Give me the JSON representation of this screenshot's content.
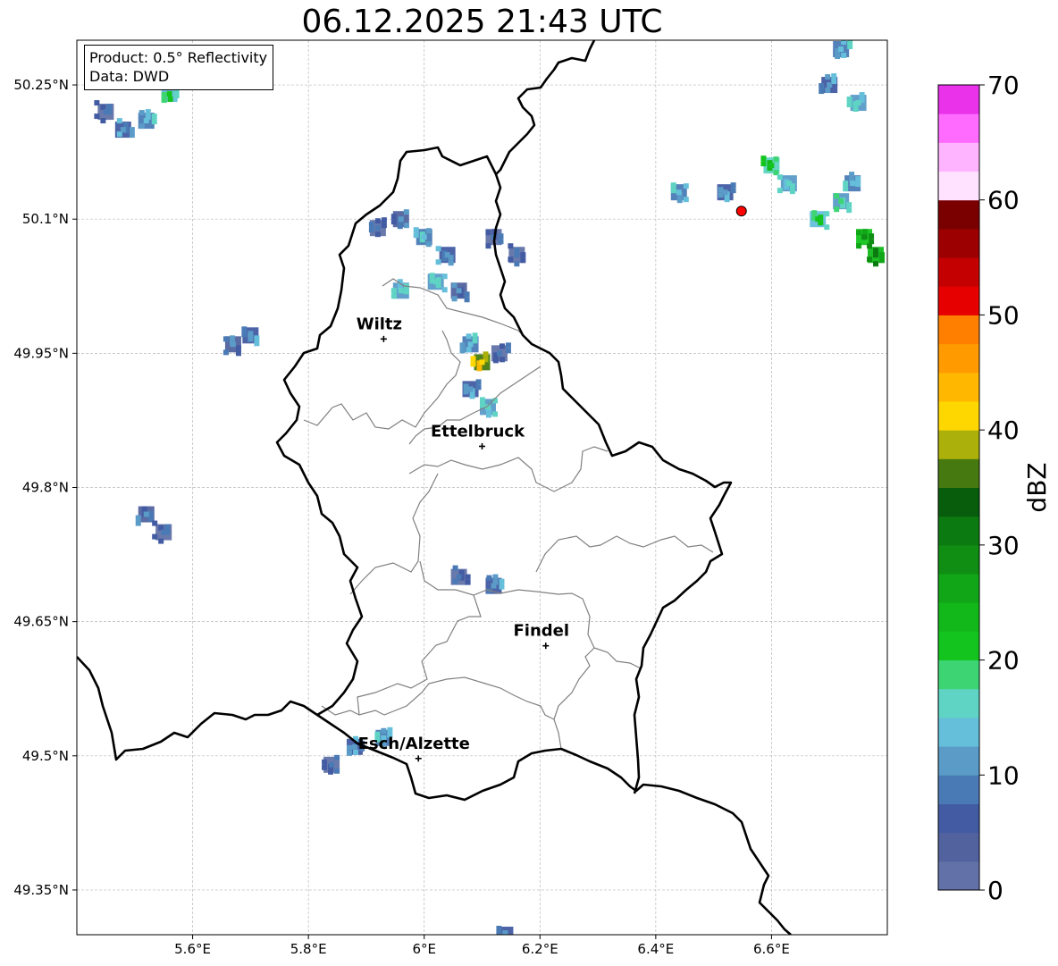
{
  "title": "06.12.2025 21:43 UTC",
  "info_box": {
    "product_line": "Product: 0.5° Reflectivity",
    "data_line": "Data: DWD"
  },
  "map": {
    "lon_range": [
      5.4,
      6.8
    ],
    "lat_range": [
      49.3,
      50.3
    ],
    "lon_ticks": [
      {
        "value": 5.6,
        "label": "5.6°E"
      },
      {
        "value": 5.8,
        "label": "5.8°E"
      },
      {
        "value": 6.0,
        "label": "6°E"
      },
      {
        "value": 6.2,
        "label": "6.2°E"
      },
      {
        "value": 6.4,
        "label": "6.4°E"
      },
      {
        "value": 6.6,
        "label": "6.6°E"
      }
    ],
    "lat_ticks": [
      {
        "value": 50.25,
        "label": "50.25°N"
      },
      {
        "value": 50.1,
        "label": "50.1°N"
      },
      {
        "value": 49.95,
        "label": "49.95°N"
      },
      {
        "value": 49.8,
        "label": "49.8°N"
      },
      {
        "value": 49.65,
        "label": "49.65°N"
      },
      {
        "value": 49.5,
        "label": "49.5°N"
      },
      {
        "value": 49.35,
        "label": "49.35°N"
      }
    ],
    "grid": true,
    "cities": [
      {
        "name": "Wiltz",
        "lon": 5.93,
        "lat": 49.966
      },
      {
        "name": "Ettelbruck",
        "lon": 6.1,
        "lat": 49.846
      },
      {
        "name": "Findel",
        "lon": 6.21,
        "lat": 49.623
      },
      {
        "name": "Esch/Alzette",
        "lon": 5.99,
        "lat": 49.497
      }
    ],
    "radar_site": {
      "lon": 6.548,
      "lat": 50.109,
      "color": "#ff0000"
    }
  },
  "colorbar": {
    "label": "dBZ",
    "min": 0,
    "max": 70,
    "step": 2.5,
    "tick_values": [
      0,
      10,
      20,
      30,
      40,
      50,
      60,
      70
    ],
    "tick_labels": [
      "0",
      "10",
      "20",
      "30",
      "40",
      "50",
      "60",
      "70"
    ],
    "colors": [
      "#6272a8",
      "#51629e",
      "#425ba2",
      "#4a7ab5",
      "#5a9bc8",
      "#65bfdb",
      "#5fd4c4",
      "#3dd574",
      "#13c41e",
      "#12b81a",
      "#11a617",
      "#0f8e13",
      "#0b7a10",
      "#075d0b",
      "#467a10",
      "#abb00a",
      "#ffd700",
      "#ffb700",
      "#ff9a00",
      "#ff7f00",
      "#e60000",
      "#c40000",
      "#9c0000",
      "#7a0000",
      "#ffe2ff",
      "#ffb4ff",
      "#ff6bff",
      "#e932e9"
    ]
  },
  "chart_data": {
    "type": "heatmap",
    "title": "06.12.2025 21:43 UTC",
    "value_label": "dBZ",
    "value_range": [
      0,
      70
    ],
    "cells": [
      {
        "lon": 5.45,
        "lat": 50.22,
        "dbz": 8
      },
      {
        "lon": 5.48,
        "lat": 50.2,
        "dbz": 12
      },
      {
        "lon": 5.52,
        "lat": 50.21,
        "dbz": 14
      },
      {
        "lon": 5.56,
        "lat": 50.24,
        "dbz": 20
      },
      {
        "lon": 5.92,
        "lat": 50.09,
        "dbz": 8
      },
      {
        "lon": 5.96,
        "lat": 50.1,
        "dbz": 10
      },
      {
        "lon": 6.0,
        "lat": 50.08,
        "dbz": 14
      },
      {
        "lon": 6.04,
        "lat": 50.06,
        "dbz": 12
      },
      {
        "lon": 6.02,
        "lat": 50.03,
        "dbz": 16
      },
      {
        "lon": 6.06,
        "lat": 50.02,
        "dbz": 10
      },
      {
        "lon": 6.12,
        "lat": 50.08,
        "dbz": 8
      },
      {
        "lon": 6.16,
        "lat": 50.06,
        "dbz": 8
      },
      {
        "lon": 5.96,
        "lat": 50.02,
        "dbz": 16
      },
      {
        "lon": 6.08,
        "lat": 49.96,
        "dbz": 14
      },
      {
        "lon": 6.1,
        "lat": 49.94,
        "dbz": 42
      },
      {
        "lon": 6.13,
        "lat": 49.95,
        "dbz": 8
      },
      {
        "lon": 6.08,
        "lat": 49.91,
        "dbz": 12
      },
      {
        "lon": 6.11,
        "lat": 49.89,
        "dbz": 16
      },
      {
        "lon": 5.7,
        "lat": 49.97,
        "dbz": 12
      },
      {
        "lon": 5.67,
        "lat": 49.96,
        "dbz": 10
      },
      {
        "lon": 5.52,
        "lat": 49.77,
        "dbz": 10
      },
      {
        "lon": 5.55,
        "lat": 49.75,
        "dbz": 8
      },
      {
        "lon": 6.06,
        "lat": 49.7,
        "dbz": 8
      },
      {
        "lon": 6.12,
        "lat": 49.69,
        "dbz": 12
      },
      {
        "lon": 5.88,
        "lat": 49.51,
        "dbz": 12
      },
      {
        "lon": 5.93,
        "lat": 49.52,
        "dbz": 14
      },
      {
        "lon": 5.84,
        "lat": 49.49,
        "dbz": 8
      },
      {
        "lon": 6.6,
        "lat": 50.16,
        "dbz": 22
      },
      {
        "lon": 6.63,
        "lat": 50.14,
        "dbz": 16
      },
      {
        "lon": 6.68,
        "lat": 50.1,
        "dbz": 20
      },
      {
        "lon": 6.72,
        "lat": 50.12,
        "dbz": 18
      },
      {
        "lon": 6.76,
        "lat": 50.08,
        "dbz": 28
      },
      {
        "lon": 6.78,
        "lat": 50.06,
        "dbz": 30
      },
      {
        "lon": 6.74,
        "lat": 50.14,
        "dbz": 14
      },
      {
        "lon": 6.7,
        "lat": 50.25,
        "dbz": 12
      },
      {
        "lon": 6.75,
        "lat": 50.23,
        "dbz": 16
      },
      {
        "lon": 6.72,
        "lat": 50.29,
        "dbz": 14
      },
      {
        "lon": 6.52,
        "lat": 50.13,
        "dbz": 12
      },
      {
        "lon": 6.44,
        "lat": 50.13,
        "dbz": 14
      },
      {
        "lon": 6.14,
        "lat": 49.3,
        "dbz": 12
      }
    ]
  }
}
